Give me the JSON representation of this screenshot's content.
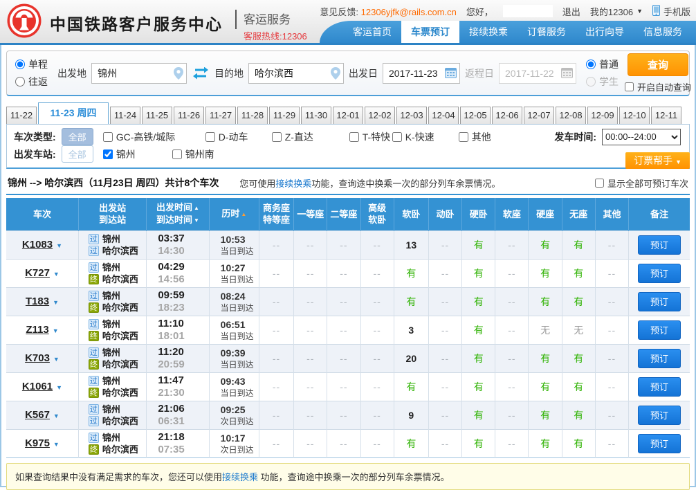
{
  "topbar": {
    "feedback_label": "意见反馈:",
    "feedback_email": "12306yjfk@rails.com.cn",
    "greeting": "您好，",
    "username": "",
    "logout": "退出",
    "my12306": "我的12306",
    "mobile": "手机版"
  },
  "header": {
    "title": "中国铁路客户服务中心",
    "subtitle": "客运服务",
    "hotline": "客服热线:12306"
  },
  "nav": {
    "items": [
      {
        "label": "客运首页",
        "active": false
      },
      {
        "label": "车票预订",
        "active": true
      },
      {
        "label": "接续换乘",
        "active": false
      },
      {
        "label": "订餐服务",
        "active": false
      },
      {
        "label": "出行向导",
        "active": false
      },
      {
        "label": "信息服务",
        "active": false
      }
    ]
  },
  "search_form": {
    "trip_type_options": [
      "单程",
      "往返"
    ],
    "trip_type_selected": "单程",
    "from_label": "出发地",
    "from_value": "锦州",
    "to_label": "目的地",
    "to_value": "哈尔滨西",
    "depart_label": "出发日",
    "depart_value": "2017-11-23",
    "return_label": "返程日",
    "return_value": "2017-11-22",
    "passenger_options": [
      "普通",
      "学生"
    ],
    "passenger_selected": "普通",
    "query_button": "查询",
    "auto_query_label": "开启自动查询"
  },
  "date_tabs": [
    {
      "label": "11-22",
      "active": false
    },
    {
      "label": "11-23 周四",
      "active": true
    },
    {
      "label": "11-24",
      "active": false
    },
    {
      "label": "11-25",
      "active": false
    },
    {
      "label": "11-26",
      "active": false
    },
    {
      "label": "11-27",
      "active": false
    },
    {
      "label": "11-28",
      "active": false
    },
    {
      "label": "11-29",
      "active": false
    },
    {
      "label": "11-30",
      "active": false
    },
    {
      "label": "12-01",
      "active": false
    },
    {
      "label": "12-02",
      "active": false
    },
    {
      "label": "12-03",
      "active": false
    },
    {
      "label": "12-04",
      "active": false
    },
    {
      "label": "12-05",
      "active": false
    },
    {
      "label": "12-06",
      "active": false
    },
    {
      "label": "12-07",
      "active": false
    },
    {
      "label": "12-08",
      "active": false
    },
    {
      "label": "12-09",
      "active": false
    },
    {
      "label": "12-10",
      "active": false
    },
    {
      "label": "12-11",
      "active": false
    }
  ],
  "filters": {
    "train_type_label": "车次类型:",
    "train_type_all": "全部",
    "train_type_options": [
      "GC-高铁/城际",
      "D-动车",
      "Z-直达",
      "T-特快",
      "K-快速",
      "其他"
    ],
    "depart_time_label": "发车时间:",
    "depart_time_value": "00:00--24:00",
    "station_label": "出发车站:",
    "station_all": "全部",
    "station_options": [
      {
        "label": "锦州",
        "checked": true
      },
      {
        "label": "锦州南",
        "checked": false
      }
    ],
    "helper_button": "订票帮手"
  },
  "summary": {
    "route": "锦州 --> 哈尔滨西（11月23日 周四）共计8个车次",
    "tip_prefix": "您可使用",
    "tip_link": "接续换乘",
    "tip_suffix": "功能，查询途中换乘一次的部分列车余票情况。",
    "show_all_label": "显示全部可预订车次"
  },
  "table": {
    "columns": [
      {
        "l1": "车次"
      },
      {
        "l1": "出发站",
        "l2": "到达站"
      },
      {
        "l1": "出发时间",
        "a1": "▲",
        "l2": "到达时间",
        "a2": "▼"
      },
      {
        "l1": "历时",
        "a1": "▲",
        "accent": true
      },
      {
        "l1": "商务座",
        "l2": "特等座"
      },
      {
        "l1": "一等座"
      },
      {
        "l1": "二等座"
      },
      {
        "l1": "高级",
        "l2": "软卧"
      },
      {
        "l1": "软卧"
      },
      {
        "l1": "动卧"
      },
      {
        "l1": "硬卧"
      },
      {
        "l1": "软座"
      },
      {
        "l1": "硬座"
      },
      {
        "l1": "无座"
      },
      {
        "l1": "其他"
      },
      {
        "l1": "备注"
      }
    ],
    "rows": [
      {
        "train": "K1083",
        "from_badge": "过",
        "from": "锦州",
        "to_badge": "过",
        "to": "哈尔滨西",
        "depart": "03:37",
        "arrive": "14:30",
        "duration": "10:53",
        "day": "当日到达",
        "seats": [
          "--",
          "--",
          "--",
          "--",
          "13",
          "--",
          "有",
          "--",
          "有",
          "有",
          "--"
        ],
        "book": "预订"
      },
      {
        "train": "K727",
        "from_badge": "过",
        "from": "锦州",
        "to_badge": "终",
        "to": "哈尔滨西",
        "depart": "04:29",
        "arrive": "14:56",
        "duration": "10:27",
        "day": "当日到达",
        "seats": [
          "--",
          "--",
          "--",
          "--",
          "有",
          "--",
          "有",
          "--",
          "有",
          "有",
          "--"
        ],
        "book": "预订"
      },
      {
        "train": "T183",
        "from_badge": "过",
        "from": "锦州",
        "to_badge": "终",
        "to": "哈尔滨西",
        "depart": "09:59",
        "arrive": "18:23",
        "duration": "08:24",
        "day": "当日到达",
        "seats": [
          "--",
          "--",
          "--",
          "--",
          "有",
          "--",
          "有",
          "--",
          "有",
          "有",
          "--"
        ],
        "book": "预订"
      },
      {
        "train": "Z113",
        "from_badge": "过",
        "from": "锦州",
        "to_badge": "终",
        "to": "哈尔滨西",
        "depart": "11:10",
        "arrive": "18:01",
        "duration": "06:51",
        "day": "当日到达",
        "seats": [
          "--",
          "--",
          "--",
          "--",
          "3",
          "--",
          "有",
          "--",
          "无",
          "无",
          "--"
        ],
        "book": "预订"
      },
      {
        "train": "K703",
        "from_badge": "过",
        "from": "锦州",
        "to_badge": "终",
        "to": "哈尔滨西",
        "depart": "11:20",
        "arrive": "20:59",
        "duration": "09:39",
        "day": "当日到达",
        "seats": [
          "--",
          "--",
          "--",
          "--",
          "20",
          "--",
          "有",
          "--",
          "有",
          "有",
          "--"
        ],
        "book": "预订"
      },
      {
        "train": "K1061",
        "from_badge": "过",
        "from": "锦州",
        "to_badge": "终",
        "to": "哈尔滨西",
        "depart": "11:47",
        "arrive": "21:30",
        "duration": "09:43",
        "day": "当日到达",
        "seats": [
          "--",
          "--",
          "--",
          "--",
          "有",
          "--",
          "有",
          "--",
          "有",
          "有",
          "--"
        ],
        "book": "预订"
      },
      {
        "train": "K567",
        "from_badge": "过",
        "from": "锦州",
        "to_badge": "过",
        "to": "哈尔滨西",
        "depart": "21:06",
        "arrive": "06:31",
        "duration": "09:25",
        "day": "次日到达",
        "seats": [
          "--",
          "--",
          "--",
          "--",
          "9",
          "--",
          "有",
          "--",
          "有",
          "有",
          "--"
        ],
        "book": "预订"
      },
      {
        "train": "K975",
        "from_badge": "过",
        "from": "锦州",
        "to_badge": "终",
        "to": "哈尔滨西",
        "depart": "21:18",
        "arrive": "07:35",
        "duration": "10:17",
        "day": "次日到达",
        "seats": [
          "--",
          "--",
          "--",
          "--",
          "有",
          "--",
          "有",
          "--",
          "有",
          "有",
          "--"
        ],
        "book": "预订"
      }
    ]
  },
  "notice": {
    "prefix": "如果查询结果中没有满足需求的车次，您还可以使用",
    "link": "接续换乘",
    "suffix": " 功能，查询途中换乘一次的部分列车余票情况。"
  },
  "icons": {
    "railway_logo_icon": "china-railway-emblem",
    "phone_icon": "mobile-phone",
    "swap_icon": "swap-arrows",
    "pin_icon": "map-pin",
    "calendar_icon": "calendar-grid",
    "chevron_down_icon": "▼"
  },
  "colors": {
    "nav_blue": "#3a93d5",
    "table_header_blue": "#3492d3",
    "accent_orange": "#ff9702",
    "book_button_blue": "#1b7fe0",
    "available_green": "#2db200",
    "hotline_red": "#e6393d",
    "email_orange": "#ff6a00",
    "link_blue": "#1c7ace",
    "logo_red": "#e8342c"
  }
}
